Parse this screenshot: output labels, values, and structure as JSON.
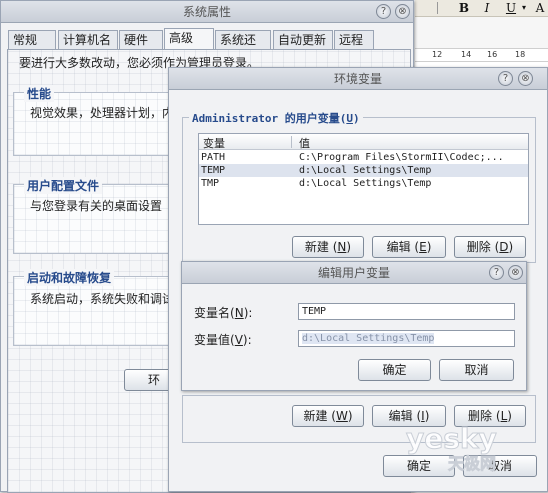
{
  "colors": {
    "accent": "#274b8c",
    "window_bg": "#f1f2f4",
    "title_gradient_top": "#dfe3e9",
    "selection": "#dde3ee"
  },
  "background_app": {
    "toolbar_buttons": [
      "B",
      "I",
      "U",
      "A"
    ],
    "ruler_ticks": [
      "12",
      "14",
      "16",
      "18"
    ]
  },
  "system_properties": {
    "title": "系统属性",
    "title_buttons": {
      "help": "?",
      "close": "⊗"
    },
    "tabs": [
      "常规",
      "计算机名",
      "硬件",
      "高级",
      "系统还原",
      "自动更新",
      "远程"
    ],
    "active_tab": "高级",
    "note": "要进行大多数改动，您必须作为管理员登录。",
    "groups": [
      {
        "title": "性能",
        "desc": "视觉效果，处理器计划，内"
      },
      {
        "title": "用户配置文件",
        "desc": "与您登录有关的桌面设置"
      },
      {
        "title": "启动和故障恢复",
        "desc": "系统启动，系统失败和调试"
      }
    ],
    "env_button": "环"
  },
  "environment_variables": {
    "title": "环境变量",
    "title_buttons": {
      "help": "?",
      "close": "⊗"
    },
    "user_section_prefix": "Administrator 的用户变量(",
    "user_section_key": "U",
    "user_section_suffix": ")",
    "columns": [
      "变量",
      "值"
    ],
    "rows": [
      {
        "name": "PATH",
        "value": "C:\\Program Files\\StormII\\Codec;..."
      },
      {
        "name": "TEMP",
        "value": "d:\\Local Settings\\Temp"
      },
      {
        "name": "TMP",
        "value": "d:\\Local Settings\\Temp"
      }
    ],
    "selected_row": 1,
    "user_buttons": [
      {
        "label": "新建",
        "key": "N"
      },
      {
        "label": "编辑",
        "key": "E"
      },
      {
        "label": "删除",
        "key": "D"
      }
    ],
    "system_buttons": [
      {
        "label": "新建",
        "key": "W"
      },
      {
        "label": "编辑",
        "key": "I"
      },
      {
        "label": "删除",
        "key": "L"
      }
    ],
    "ok": "确定",
    "cancel": "取消"
  },
  "edit_user_variable": {
    "title": "编辑用户变量",
    "title_buttons": {
      "help": "?",
      "close": "⊗"
    },
    "name_label": "变量名",
    "name_key": "N",
    "name_value": "TEMP",
    "value_label": "变量值",
    "value_key": "V",
    "value_value": "d:\\Local Settings\\Temp",
    "ok": "确定",
    "cancel": "取消"
  },
  "watermark": {
    "brand": "yesky",
    "sub": "天极网"
  }
}
